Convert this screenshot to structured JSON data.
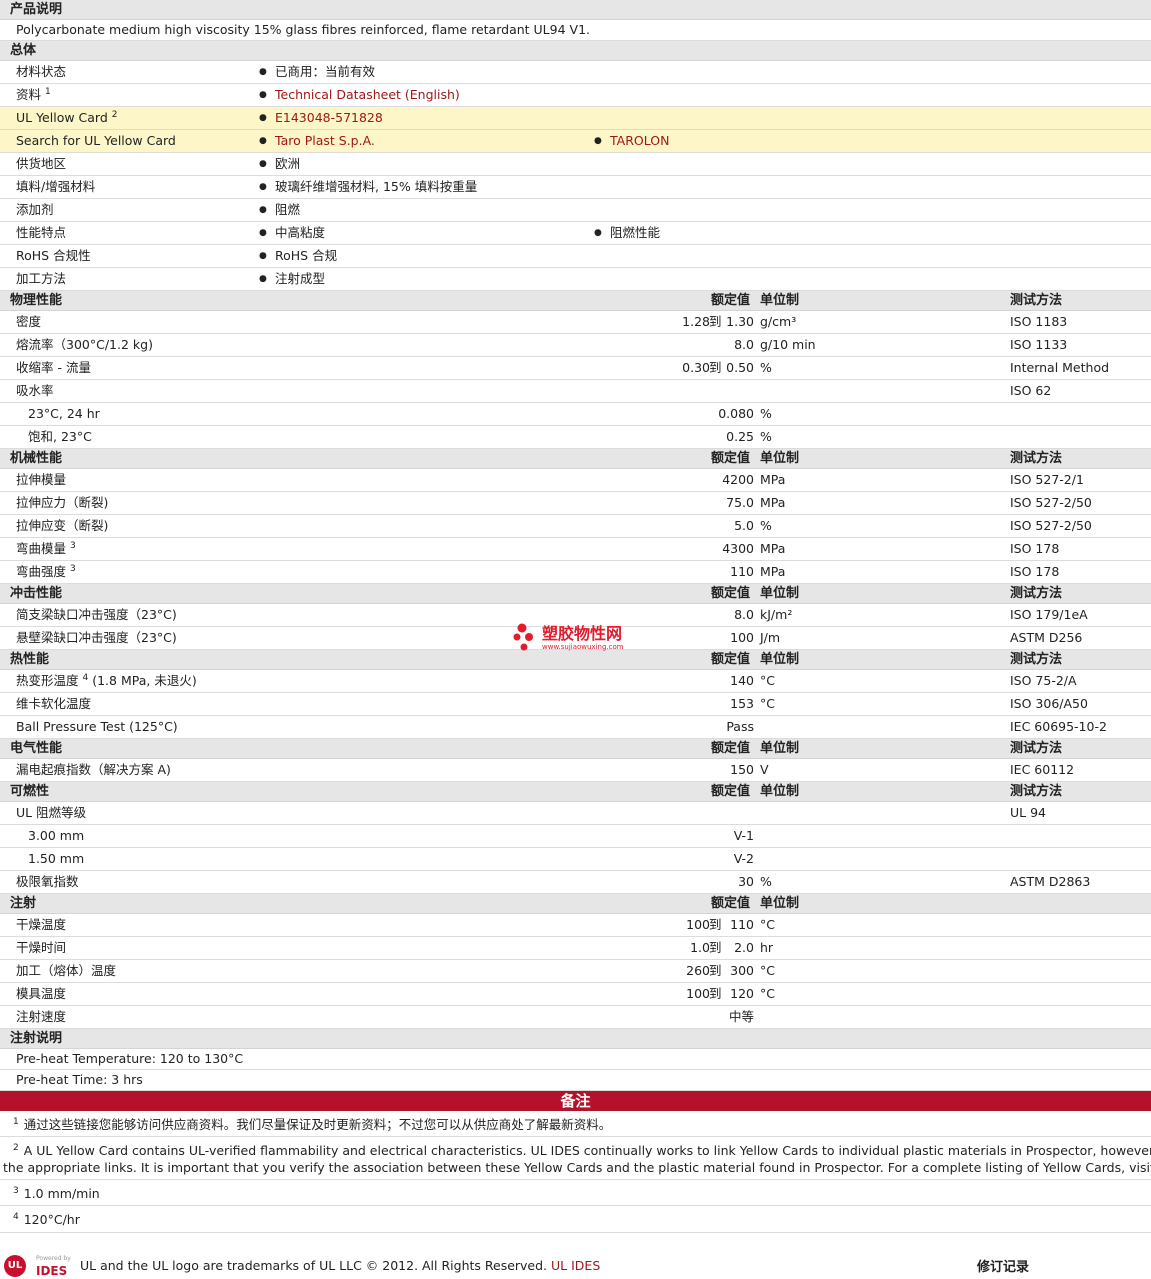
{
  "product_desc": {
    "heading": "产品说明",
    "text": "Polycarbonate medium high viscosity 15% glass fibres reinforced, flame retardant UL94 V1."
  },
  "general": {
    "heading": "总体",
    "rows": [
      {
        "label": "材料状态",
        "v1": "已商用：当前有效"
      },
      {
        "label": "资料",
        "sup": "1",
        "v1": "Technical Datasheet (English)",
        "link": true
      },
      {
        "label": "UL Yellow Card",
        "sup": "2",
        "v1": "E143048-571828",
        "link": true,
        "yellow": true
      },
      {
        "label": "Search for UL Yellow Card",
        "v1": "Taro Plast S.p.A.",
        "v2": "TAROLON",
        "link": true,
        "yellow": true
      },
      {
        "label": "供货地区",
        "v1": "欧洲"
      },
      {
        "label": "填料/增强材料",
        "v1": "玻璃纤维增强材料, 15% 填料按重量"
      },
      {
        "label": "添加剂",
        "v1": "阻燃"
      },
      {
        "label": "性能特点",
        "v1": "中高粘度",
        "v2": "阻燃性能"
      },
      {
        "label": "RoHS 合规性",
        "v1": "RoHS 合规"
      },
      {
        "label": "加工方法",
        "v1": "注射成型"
      }
    ]
  },
  "col_headers": {
    "value": "额定值",
    "unit": "单位制",
    "method": "测试方法"
  },
  "sections": [
    {
      "title": "物理性能",
      "show_method": true,
      "rows": [
        {
          "label": "密度",
          "v1": "1.28",
          "to": "到",
          "v2": "1.30",
          "unit": "g/cm³",
          "method": "ISO 1183"
        },
        {
          "label": "熔流率（300°C/1.2 kg)",
          "v2": "8.0",
          "unit": "g/10 min",
          "method": "ISO 1133"
        },
        {
          "label": "收缩率 - 流量",
          "v1": "0.30",
          "to": "到",
          "v2": "0.50",
          "unit": "%",
          "method": "Internal Method"
        },
        {
          "label": "吸水率",
          "method": "ISO 62"
        },
        {
          "label": "23°C, 24 hr",
          "sub": true,
          "v2": "0.080",
          "unit": "%"
        },
        {
          "label": "饱和, 23°C",
          "sub": true,
          "v2": "0.25",
          "unit": "%"
        }
      ]
    },
    {
      "title": "机械性能",
      "show_method": true,
      "rows": [
        {
          "label": "拉伸模量",
          "v2": "4200",
          "unit": "MPa",
          "method": "ISO 527-2/1"
        },
        {
          "label": "拉伸应力（断裂)",
          "v2": "75.0",
          "unit": "MPa",
          "method": "ISO 527-2/50"
        },
        {
          "label": "拉伸应变（断裂)",
          "v2": "5.0",
          "unit": "%",
          "method": "ISO 527-2/50"
        },
        {
          "label": "弯曲模量",
          "sup": "3",
          "v2": "4300",
          "unit": "MPa",
          "method": "ISO 178"
        },
        {
          "label": "弯曲强度",
          "sup": "3",
          "v2": "110",
          "unit": "MPa",
          "method": "ISO 178"
        }
      ]
    },
    {
      "title": "冲击性能",
      "show_method": true,
      "rows": [
        {
          "label": "简支梁缺口冲击强度（23°C)",
          "v2": "8.0",
          "unit": "kJ/m²",
          "method": "ISO 179/1eA"
        },
        {
          "label": "悬壁梁缺口冲击强度（23°C)",
          "v2": "100",
          "unit": "J/m",
          "method": "ASTM D256"
        }
      ]
    },
    {
      "title": "热性能",
      "show_method": true,
      "rows": [
        {
          "label": "热变形温度",
          "sup": "4",
          "label2": "(1.8 MPa, 未退火)",
          "v2": "140",
          "unit": "°C",
          "method": "ISO 75-2/A"
        },
        {
          "label": "维卡软化温度",
          "v2": "153",
          "unit": "°C",
          "method": "ISO 306/A50"
        },
        {
          "label": "Ball Pressure Test (125°C)",
          "v2": "Pass",
          "method": "IEC 60695-10-2"
        }
      ]
    },
    {
      "title": "电气性能",
      "show_method": true,
      "rows": [
        {
          "label": "漏电起痕指数（解决方案 A)",
          "v2": "150",
          "unit": "V",
          "method": "IEC 60112"
        }
      ]
    },
    {
      "title": "可燃性",
      "show_method": true,
      "rows": [
        {
          "label": "UL 阻燃等级",
          "method": "UL 94"
        },
        {
          "label": "3.00 mm",
          "sub": true,
          "v2": "V-1"
        },
        {
          "label": "1.50 mm",
          "sub": true,
          "v2": "V-2"
        },
        {
          "label": "极限氧指数",
          "v2": "30",
          "unit": "%",
          "method": "ASTM D2863"
        }
      ]
    },
    {
      "title": "注射",
      "show_method": false,
      "rows": [
        {
          "label": "干燥温度",
          "v1": "100",
          "to": "到",
          "v2": "110",
          "unit": "°C"
        },
        {
          "label": "干燥时间",
          "v1": "1.0",
          "to": "到",
          "v2": "2.0",
          "unit": "hr"
        },
        {
          "label": "加工（熔体）温度",
          "v1": "260",
          "to": "到",
          "v2": "300",
          "unit": "°C"
        },
        {
          "label": "模具温度",
          "v1": "100",
          "to": "到",
          "v2": "120",
          "unit": "°C"
        },
        {
          "label": "注射速度",
          "v2": "中等"
        }
      ]
    }
  ],
  "injection_notes": {
    "heading": "注射说明",
    "lines": [
      "Pre-heat Temperature: 120 to 130°C",
      "Pre-heat Time: 3 hrs"
    ]
  },
  "notes": {
    "banner": "备注",
    "items": [
      {
        "n": "1",
        "text": "通过这些链接您能够访问供应商资料。我们尽量保证及时更新资料；不过您可以从供应商处了解最新资料。"
      },
      {
        "n": "2",
        "text": "A UL Yellow Card contains UL-verified flammability and electrical characteristics. UL IDES continually works to link Yellow Cards to individual plastic materials in Prospector, however this list may",
        "text2": "the appropriate links. It is important that you verify the association between these Yellow Cards and the plastic material found in Prospector. For a complete listing of Yellow Cards, visit the UL Yellow"
      },
      {
        "n": "3",
        "text": "1.0 mm/min"
      },
      {
        "n": "4",
        "text": "120°C/hr"
      }
    ]
  },
  "watermark": {
    "name": "塑胶物性网",
    "url": "www.sujiaowuxing.com"
  },
  "footer": {
    "logo_small": "Powered by",
    "logo_text": "IDES",
    "trademark": "UL and the UL logo are trademarks of UL LLC © 2012. All Rights Reserved.",
    "trademark_link": "UL IDES",
    "revision": "修订记录"
  }
}
